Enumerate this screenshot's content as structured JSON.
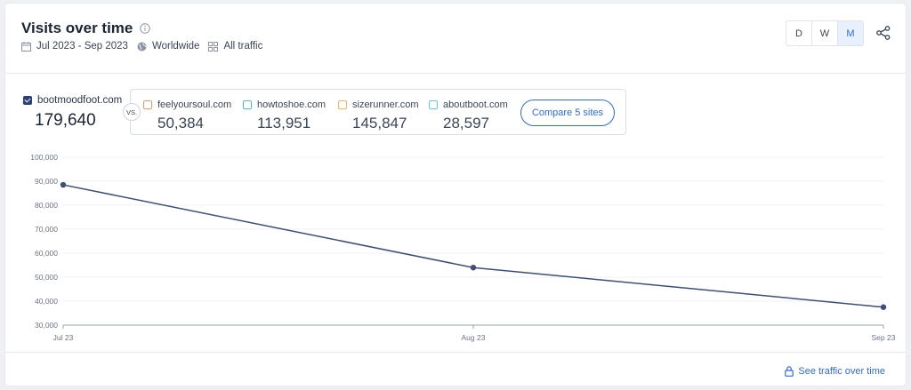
{
  "header": {
    "title": "Visits over time",
    "date_range": "Jul 2023 - Sep 2023",
    "region": "Worldwide",
    "traffic": "All traffic",
    "periods": [
      "D",
      "W",
      "M"
    ],
    "active_period": "M",
    "accent_color": "#2f6bd8"
  },
  "main_site": {
    "name": "bootmoodfoot.com",
    "value": "179,640",
    "color": "#2e3f73"
  },
  "vs_label": "VS.",
  "competitors": [
    {
      "name": "feelyoursoul.com",
      "value": "50,384",
      "color": "#f0926b"
    },
    {
      "name": "howtoshoe.com",
      "value": "113,951",
      "color": "#4dc4b8"
    },
    {
      "name": "sizerunner.com",
      "value": "145,847",
      "color": "#f3b45a"
    },
    {
      "name": "aboutboot.com",
      "value": "28,597",
      "color": "#5fd0d8"
    }
  ],
  "compare_button": "Compare 5 sites",
  "chart_data": {
    "type": "line",
    "categories": [
      "Jul 23",
      "Aug 23",
      "Sep 23"
    ],
    "series": [
      {
        "name": "bootmoodfoot.com",
        "values": [
          88500,
          54000,
          37500
        ],
        "color": "#3d4d7c"
      }
    ],
    "yticks": [
      "30,000",
      "40,000",
      "50,000",
      "60,000",
      "70,000",
      "80,000",
      "90,000",
      "100,000"
    ],
    "ylim": [
      30000,
      100000
    ],
    "grid": true
  },
  "footer": {
    "link_label": "See traffic over time"
  }
}
